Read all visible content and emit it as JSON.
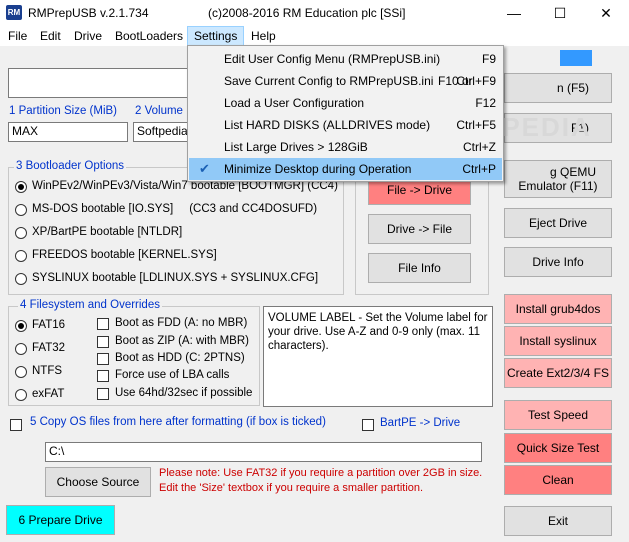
{
  "window": {
    "title": "RMPrepUSB v.2.1.734",
    "copyright": "(c)2008-2016 RM Education plc [SSi]",
    "icon_label": "RM"
  },
  "menu": [
    "File",
    "Edit",
    "Drive",
    "BootLoaders",
    "Settings",
    "Help"
  ],
  "settings_menu": [
    {
      "label": "Edit User Config Menu (RMPrepUSB.ini)",
      "extra": "",
      "shortcut": "F9",
      "checked": false
    },
    {
      "label": "Save Current Config to RMPrepUSB.ini",
      "extra": "F10 or",
      "shortcut": "Ctrl+F9",
      "checked": false
    },
    {
      "label": "Load a User Configuration",
      "extra": "",
      "shortcut": "F12",
      "checked": false
    },
    {
      "label": "List HARD DISKS (ALLDRIVES mode)",
      "extra": "",
      "shortcut": "Ctrl+F5",
      "checked": false
    },
    {
      "label": "List Large Drives > 128GiB",
      "extra": "",
      "shortcut": "Ctrl+Z",
      "checked": false
    },
    {
      "label": "Minimize Desktop during Operation",
      "extra": "",
      "shortcut": "Ctrl+P",
      "checked": true
    }
  ],
  "watermark": "SOFTPEDIA",
  "partition": {
    "size_label": "1 Partition Size (MiB)",
    "size_value": "MAX",
    "volume_label": "2 Volume L",
    "volume_value": "Softpedia"
  },
  "bootloader": {
    "title": "3 Bootloader Options",
    "options": [
      "WinPEv2/WinPEv3/Vista/Win7 bootable [BOOTMGR] (CC4)",
      "MS-DOS bootable [IO.SYS]     (CC3 and CC4DOSUFD)",
      "XP/BartPE bootable [NTLDR]",
      "FREEDOS bootable [KERNEL.SYS]",
      "SYSLINUX bootable [LDLINUX.SYS + SYSLINUX.CFG]"
    ],
    "selected": 0
  },
  "filesystem": {
    "title": "4 Filesystem and Overrides",
    "options": [
      "FAT16",
      "FAT32",
      "NTFS",
      "exFAT"
    ],
    "selected": 0,
    "overrides": [
      "Boot as FDD (A: no MBR)",
      "Boot as ZIP (A: with MBR)",
      "Boot as HDD (C: 2PTNS)",
      "Force use of LBA calls",
      "Use 64hd/32sec if possible"
    ]
  },
  "info_text": "VOLUME LABEL - Set the Volume label for your drive. Use A-Z and 0-9 only (max. 11 characters).",
  "copy_os": {
    "label": "5 Copy OS files from here after formatting (if box is ticked)",
    "bartpe": "BartPE -> Drive",
    "path": "C:\\",
    "choose_source": "Choose Source"
  },
  "note_lines": [
    "Please note: Use FAT32 if you require a partition over 2GB in size.",
    "Edit the 'Size' textbox if you require a smaller partition."
  ],
  "buttons": {
    "prepare": "6 Prepare Drive",
    "file_to_drive": "File -> Drive",
    "drive_to_file": "Drive -> File",
    "file_info": "File Info",
    "btn_f5_partial": "n (F5)",
    "btn_f1_partial": "F1)",
    "qemu_line1": "g QEMU",
    "qemu_line2": "Emulator (F11)",
    "eject": "Eject Drive",
    "drive_info": "Drive Info",
    "grub4dos": "Install grub4dos",
    "syslinux": "Install syslinux",
    "ext": "Create Ext2/3/4 FS",
    "test_speed": "Test Speed",
    "quick_size": "Quick Size Test",
    "clean": "Clean",
    "exit": "Exit"
  },
  "window_controls": {
    "minimize": "—",
    "maximize": "☐",
    "close": "✕"
  }
}
